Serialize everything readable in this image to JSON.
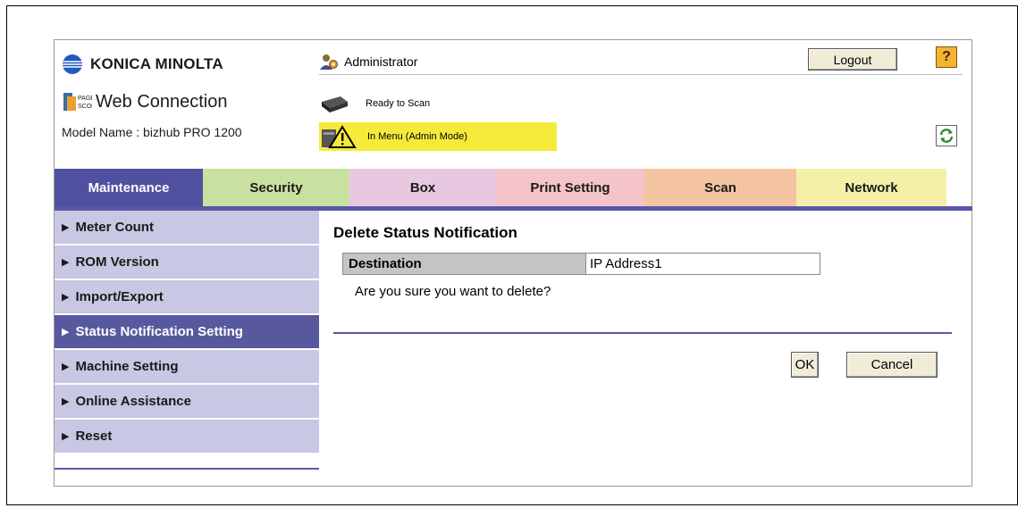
{
  "header": {
    "brand": "KONICA MINOLTA",
    "product": "Web Connection",
    "model_name": "Model Name : bizhub PRO 1200",
    "user": "Administrator",
    "logout_label": "Logout",
    "help_label": "?",
    "scan_status": "Ready to Scan",
    "mode_status": "In Menu (Admin Mode)"
  },
  "tabs": [
    {
      "label": "Maintenance",
      "bg": "#5050a0",
      "color": "#ffffff"
    },
    {
      "label": "Security",
      "bg": "#c8e0a0",
      "color": "#1a1a1a"
    },
    {
      "label": "Box",
      "bg": "#e8c8e0",
      "color": "#1a1a1a"
    },
    {
      "label": "Print Setting",
      "bg": "#f4c4c8",
      "color": "#1a1a1a"
    },
    {
      "label": "Scan",
      "bg": "#f4c4a0",
      "color": "#1a1a1a"
    },
    {
      "label": "Network",
      "bg": "#f4f0a8",
      "color": "#1a1a1a"
    }
  ],
  "sidebar": {
    "items": [
      {
        "label": "Meter Count"
      },
      {
        "label": "ROM Version"
      },
      {
        "label": "Import/Export"
      },
      {
        "label": "Status Notification Setting",
        "active": true
      },
      {
        "label": "Machine Setting"
      },
      {
        "label": "Online Assistance"
      },
      {
        "label": "Reset"
      }
    ]
  },
  "main": {
    "title": "Delete Status Notification",
    "destination_label": "Destination",
    "destination_value": "IP Address1",
    "confirm_text": "Are you sure you want to delete?",
    "ok_label": "OK",
    "cancel_label": "Cancel"
  },
  "colors": {
    "accent": "#5858a8",
    "sidebar_bg": "#c8c8e4",
    "warning_bg": "#f5ea3a"
  }
}
